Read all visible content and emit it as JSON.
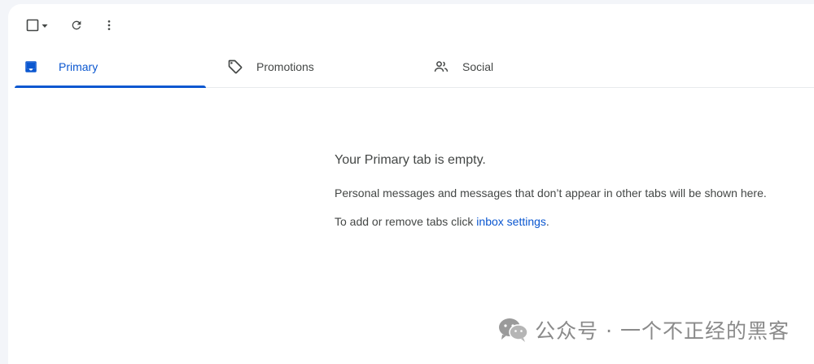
{
  "toolbar": {
    "select_all_icon": "checkbox-outline-icon",
    "select_menu_icon": "caret-down-icon",
    "refresh_icon": "refresh-icon",
    "more_icon": "more-vert-icon"
  },
  "tabs": [
    {
      "label": "Primary",
      "icon": "inbox-icon",
      "active": true
    },
    {
      "label": "Promotions",
      "icon": "tag-icon",
      "active": false
    },
    {
      "label": "Social",
      "icon": "people-icon",
      "active": false
    }
  ],
  "empty_state": {
    "title": "Your Primary tab is empty.",
    "description": "Personal messages and messages that don’t appear in other tabs will be shown here.",
    "hint_prefix": "To add or remove tabs click ",
    "hint_link": "inbox settings",
    "hint_suffix": "."
  },
  "watermark": {
    "text": "公众号 · 一个不正经的黑客"
  },
  "colors": {
    "accent": "#0b57d0",
    "text": "#444746",
    "background": "#f3f5f9",
    "panel": "#ffffff"
  }
}
